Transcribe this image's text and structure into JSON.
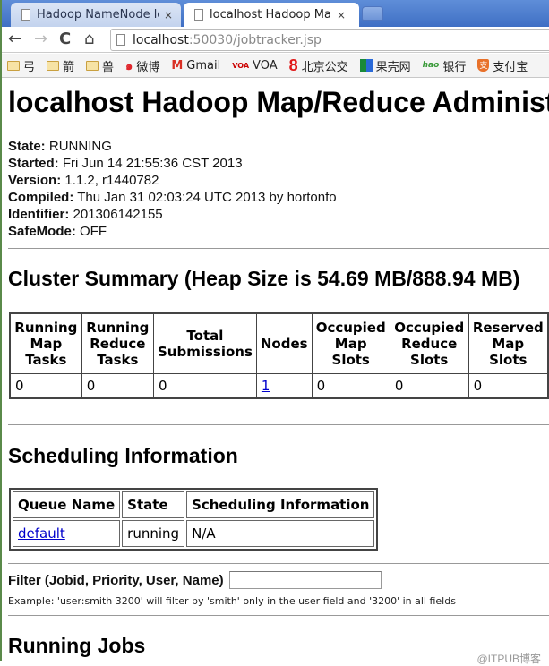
{
  "browser": {
    "tabs": [
      {
        "title": "Hadoop NameNode loca",
        "active": false
      },
      {
        "title": "localhost Hadoop Map/R",
        "active": true
      }
    ],
    "close_glyph": "×",
    "nav": {
      "back": "←",
      "forward": "→",
      "reload": "C",
      "home": "⌂"
    },
    "url": {
      "host": "localhost",
      "path": ":50030/jobtracker.jsp"
    },
    "bookmarks": [
      {
        "label": "弓",
        "icon": "folder-icon"
      },
      {
        "label": "箭",
        "icon": "folder-icon"
      },
      {
        "label": "兽",
        "icon": "folder-icon"
      },
      {
        "label": "微博",
        "icon": "weibo-icon"
      },
      {
        "label": "Gmail",
        "icon": "gmail-icon"
      },
      {
        "label": "VOA",
        "icon": "voa-icon"
      },
      {
        "label": "北京公交",
        "icon": "bus-8-icon"
      },
      {
        "label": "果壳网",
        "icon": "guokr-icon"
      },
      {
        "label": "银行",
        "icon": "hao-icon"
      },
      {
        "label": "支付宝",
        "icon": "alipay-icon"
      }
    ],
    "icon_glyphs": {
      "weibo": "๑",
      "gmail": "M",
      "voa": "VOA",
      "eight": "8",
      "hao": "hao",
      "alipay": "支"
    }
  },
  "page": {
    "title": "localhost Hadoop Map/Reduce Administration",
    "info": [
      {
        "label": "State:",
        "value": "RUNNING"
      },
      {
        "label": "Started:",
        "value": "Fri Jun 14 21:55:36 CST 2013"
      },
      {
        "label": "Version:",
        "value": "1.1.2, r1440782"
      },
      {
        "label": "Compiled:",
        "value": "Thu Jan 31 02:03:24 UTC 2013 by hortonfo"
      },
      {
        "label": "Identifier:",
        "value": "201306142155"
      },
      {
        "label": "SafeMode:",
        "value": "OFF"
      }
    ],
    "cluster_summary": {
      "heading": "Cluster Summary (Heap Size is 54.69 MB/888.94 MB)",
      "columns": [
        "Running Map Tasks",
        "Running Reduce Tasks",
        "Total Submissions",
        "Nodes",
        "Occupied Map Slots",
        "Occupied Reduce Slots",
        "Reserved Map Slots"
      ],
      "values": [
        "0",
        "0",
        "0",
        "1",
        "0",
        "0",
        "0"
      ]
    },
    "scheduling": {
      "heading": "Scheduling Information",
      "columns": [
        "Queue Name",
        "State",
        "Scheduling Information"
      ],
      "rows": [
        [
          "default",
          "running",
          "N/A"
        ]
      ]
    },
    "filter": {
      "label": "Filter (Jobid, Priority, User, Name)",
      "value": "",
      "example": "Example: 'user:smith 3200' will filter by 'smith' only in the user field and '3200' in all fields"
    },
    "running_jobs_heading": "Running Jobs",
    "watermark": "@ITPUB博客"
  }
}
